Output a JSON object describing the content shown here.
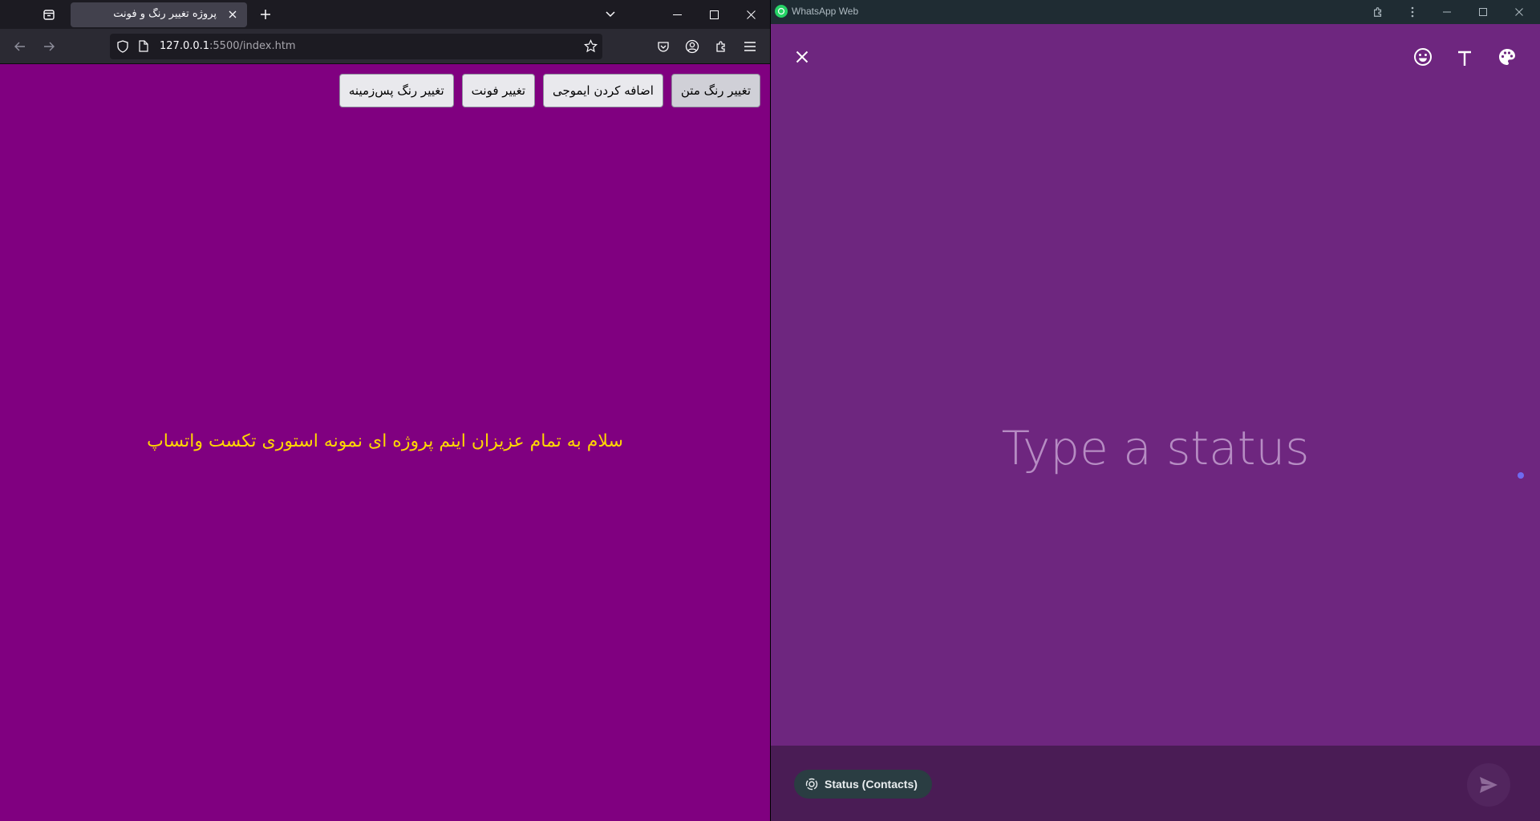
{
  "firefox": {
    "tab_title": "پروژه تغییر رنگ و فونت",
    "url_host": "127.0.0.1",
    "url_rest": ":5500/index.htm",
    "page_bg": "#800080",
    "text_color": "#ffd700",
    "buttons": [
      {
        "label": "تغییر رنگ متن"
      },
      {
        "label": "اضافه کردن ایموجی"
      },
      {
        "label": "تغییر فونت"
      },
      {
        "label": "تغییر رنگ پس‌زمینه"
      }
    ],
    "story_text": "سلام به تمام عزیزان اینم پروژه ای نمونه استوری تکست واتساپ"
  },
  "whatsapp": {
    "window_title": "WhatsApp Web",
    "placeholder": "Type a status",
    "audience_label": "Status (Contacts)",
    "bg": "#6e267f",
    "icons": [
      "close-icon",
      "emoji-icon",
      "text-font-icon",
      "palette-icon",
      "send-icon"
    ]
  }
}
